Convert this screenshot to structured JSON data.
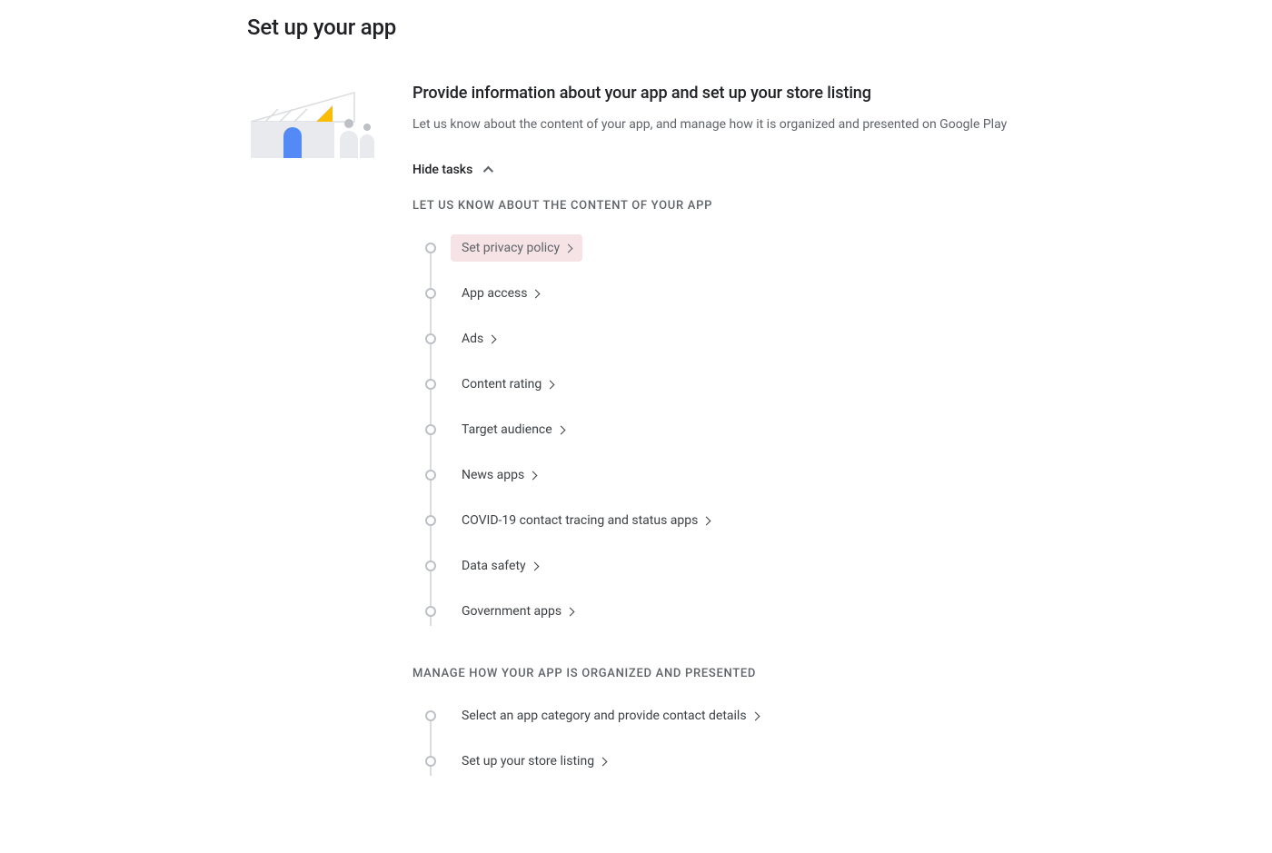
{
  "pageTitle": "Set up your app",
  "section": {
    "heading": "Provide information about your app and set up your store listing",
    "description": "Let us know about the content of your app, and manage how it is organized and presented on Google Play"
  },
  "toggleLabel": "Hide tasks",
  "groups": [
    {
      "label": "LET US KNOW ABOUT THE CONTENT OF YOUR APP",
      "tasks": [
        {
          "label": "Set privacy policy",
          "highlighted": true
        },
        {
          "label": "App access",
          "highlighted": false
        },
        {
          "label": "Ads",
          "highlighted": false
        },
        {
          "label": "Content rating",
          "highlighted": false
        },
        {
          "label": "Target audience",
          "highlighted": false
        },
        {
          "label": "News apps",
          "highlighted": false
        },
        {
          "label": "COVID-19 contact tracing and status apps",
          "highlighted": false
        },
        {
          "label": "Data safety",
          "highlighted": false
        },
        {
          "label": "Government apps",
          "highlighted": false
        }
      ]
    },
    {
      "label": "MANAGE HOW YOUR APP IS ORGANIZED AND PRESENTED",
      "tasks": [
        {
          "label": "Select an app category and provide contact details",
          "highlighted": false
        },
        {
          "label": "Set up your store listing",
          "highlighted": false
        }
      ]
    }
  ]
}
